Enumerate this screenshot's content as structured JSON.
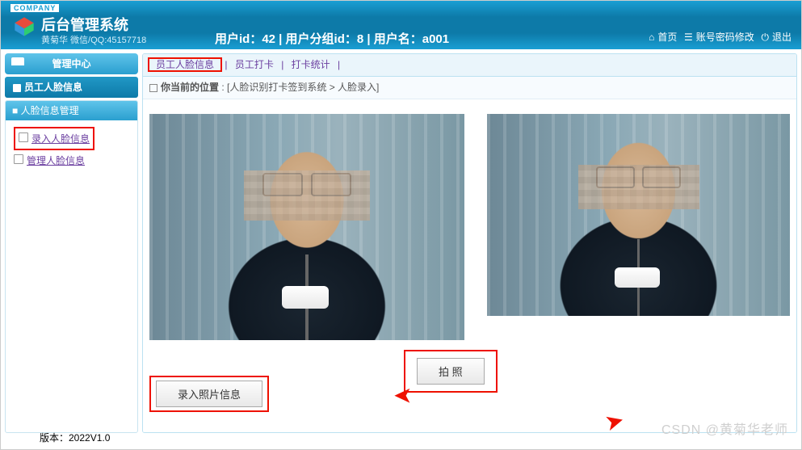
{
  "header": {
    "company_tag": "COMPANY",
    "title": "后台管理系统",
    "subtitle": "黄菊华 微信/QQ:45157718",
    "user_info": "用户id：42 | 用户分组id：8 | 用户名：a001",
    "nav": {
      "home": "首页",
      "account": "账号密码修改",
      "logout": "退出"
    }
  },
  "sidebar": {
    "center": "管理中心",
    "cat1": "员工人脸信息",
    "panel_title": "人脸信息管理",
    "links": {
      "enroll": "录入人脸信息",
      "manage": "管理人脸信息"
    }
  },
  "tabs": {
    "t1": "员工人脸信息",
    "t2": "员工打卡",
    "t3": "打卡统计"
  },
  "breadcrumb": {
    "label": "你当前的位置",
    "path": "[人脸识别打卡签到系统 > 人脸录入]"
  },
  "buttons": {
    "capture": "拍 照",
    "save": "录入照片信息"
  },
  "footer": "版本：2022V1.0",
  "watermark": "CSDN @黄菊华老师"
}
